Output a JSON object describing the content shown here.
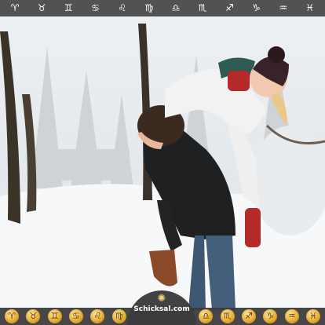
{
  "zodiac_bar": {
    "signs": [
      {
        "glyph": "♈",
        "icon": "aries-icon"
      },
      {
        "glyph": "♉",
        "icon": "taurus-icon"
      },
      {
        "glyph": "♊",
        "icon": "gemini-icon"
      },
      {
        "glyph": "♋",
        "icon": "cancer-icon"
      },
      {
        "glyph": "♌",
        "icon": "leo-icon"
      },
      {
        "glyph": "♍",
        "icon": "virgo-icon"
      },
      {
        "glyph": "♎",
        "icon": "libra-icon"
      },
      {
        "glyph": "♏",
        "icon": "scorpio-icon"
      },
      {
        "glyph": "♐",
        "icon": "sagittarius-icon"
      },
      {
        "glyph": "♑",
        "icon": "capricorn-icon"
      },
      {
        "glyph": "♒",
        "icon": "aquarius-icon"
      },
      {
        "glyph": "♓",
        "icon": "pisces-icon"
      }
    ]
  },
  "bottom_bar": {
    "gold_signs": [
      "♈",
      "♉",
      "♊",
      "♋",
      "♌",
      "♍",
      "♎",
      "♏",
      "♐",
      "♑",
      "♒",
      "♓"
    ]
  },
  "logo": {
    "brand": "Schicksal.com"
  },
  "colors": {
    "bar": "#464648",
    "gold": "#e3a72c"
  }
}
